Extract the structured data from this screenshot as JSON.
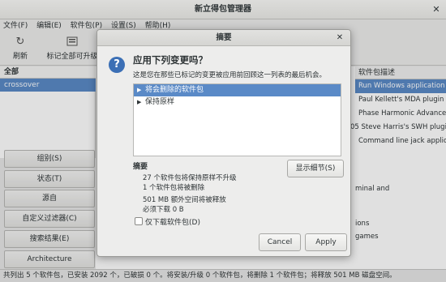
{
  "window": {
    "title": "新立得包管理器",
    "close_glyph": "✕"
  },
  "menu": [
    "文件(F)",
    "编辑(E)",
    "软件包(P)",
    "设置(S)",
    "帮助(H)"
  ],
  "toolbar": {
    "reload_label": "刷新",
    "mark_upgrades_label": "标记全部可升级",
    "reload_icon": "refresh-icon",
    "mark_icon": "mark-upgrades-icon"
  },
  "left_pane": {
    "header": "全部",
    "selected_item": "crossover",
    "buttons": [
      "组别(S)",
      "状态(T)",
      "源自",
      "自定义过滤器(C)",
      "搜索结果(E)",
      "Architecture"
    ]
  },
  "right_pane": {
    "desc_header": "软件包描述",
    "desc_rows": [
      "Run Windows application",
      "Paul Kellett's MDA plugin",
      "Phase Harmonic Advance",
      "Steve Harris's SWH plugi",
      "Command line jack applic"
    ],
    "row_prefix_4": "05",
    "detail_lines": [
      "minal and",
      "ions",
      "games"
    ]
  },
  "status_bar": "共列出 5 个软件包，已安装 2092 个，已破损 0 个。将安装/升级 0 个软件包，将删除 1 个软件包；将释放 501 MB 磁盘空间。",
  "dialog": {
    "title": "摘要",
    "heading": "应用下列变更吗？",
    "subtitle": "这是您在那些已标记的变更被应用前回顾这一列表的最后机会。",
    "tree": [
      {
        "label": "将会删除的软件包",
        "selected": true
      },
      {
        "label": "保持原样",
        "selected": false
      }
    ],
    "summary_title": "摘要",
    "show_details": "显示细节(S)",
    "summary_lines": [
      "27 个软件包将保持原样不升级",
      "1 个软件包将被删除",
      "501 MB 额外空间将被释放",
      "必须下载 0  B"
    ],
    "download_only": "仅下载软件包(D)",
    "cancel": "Cancel",
    "apply": "Apply",
    "icon": "question-icon"
  }
}
